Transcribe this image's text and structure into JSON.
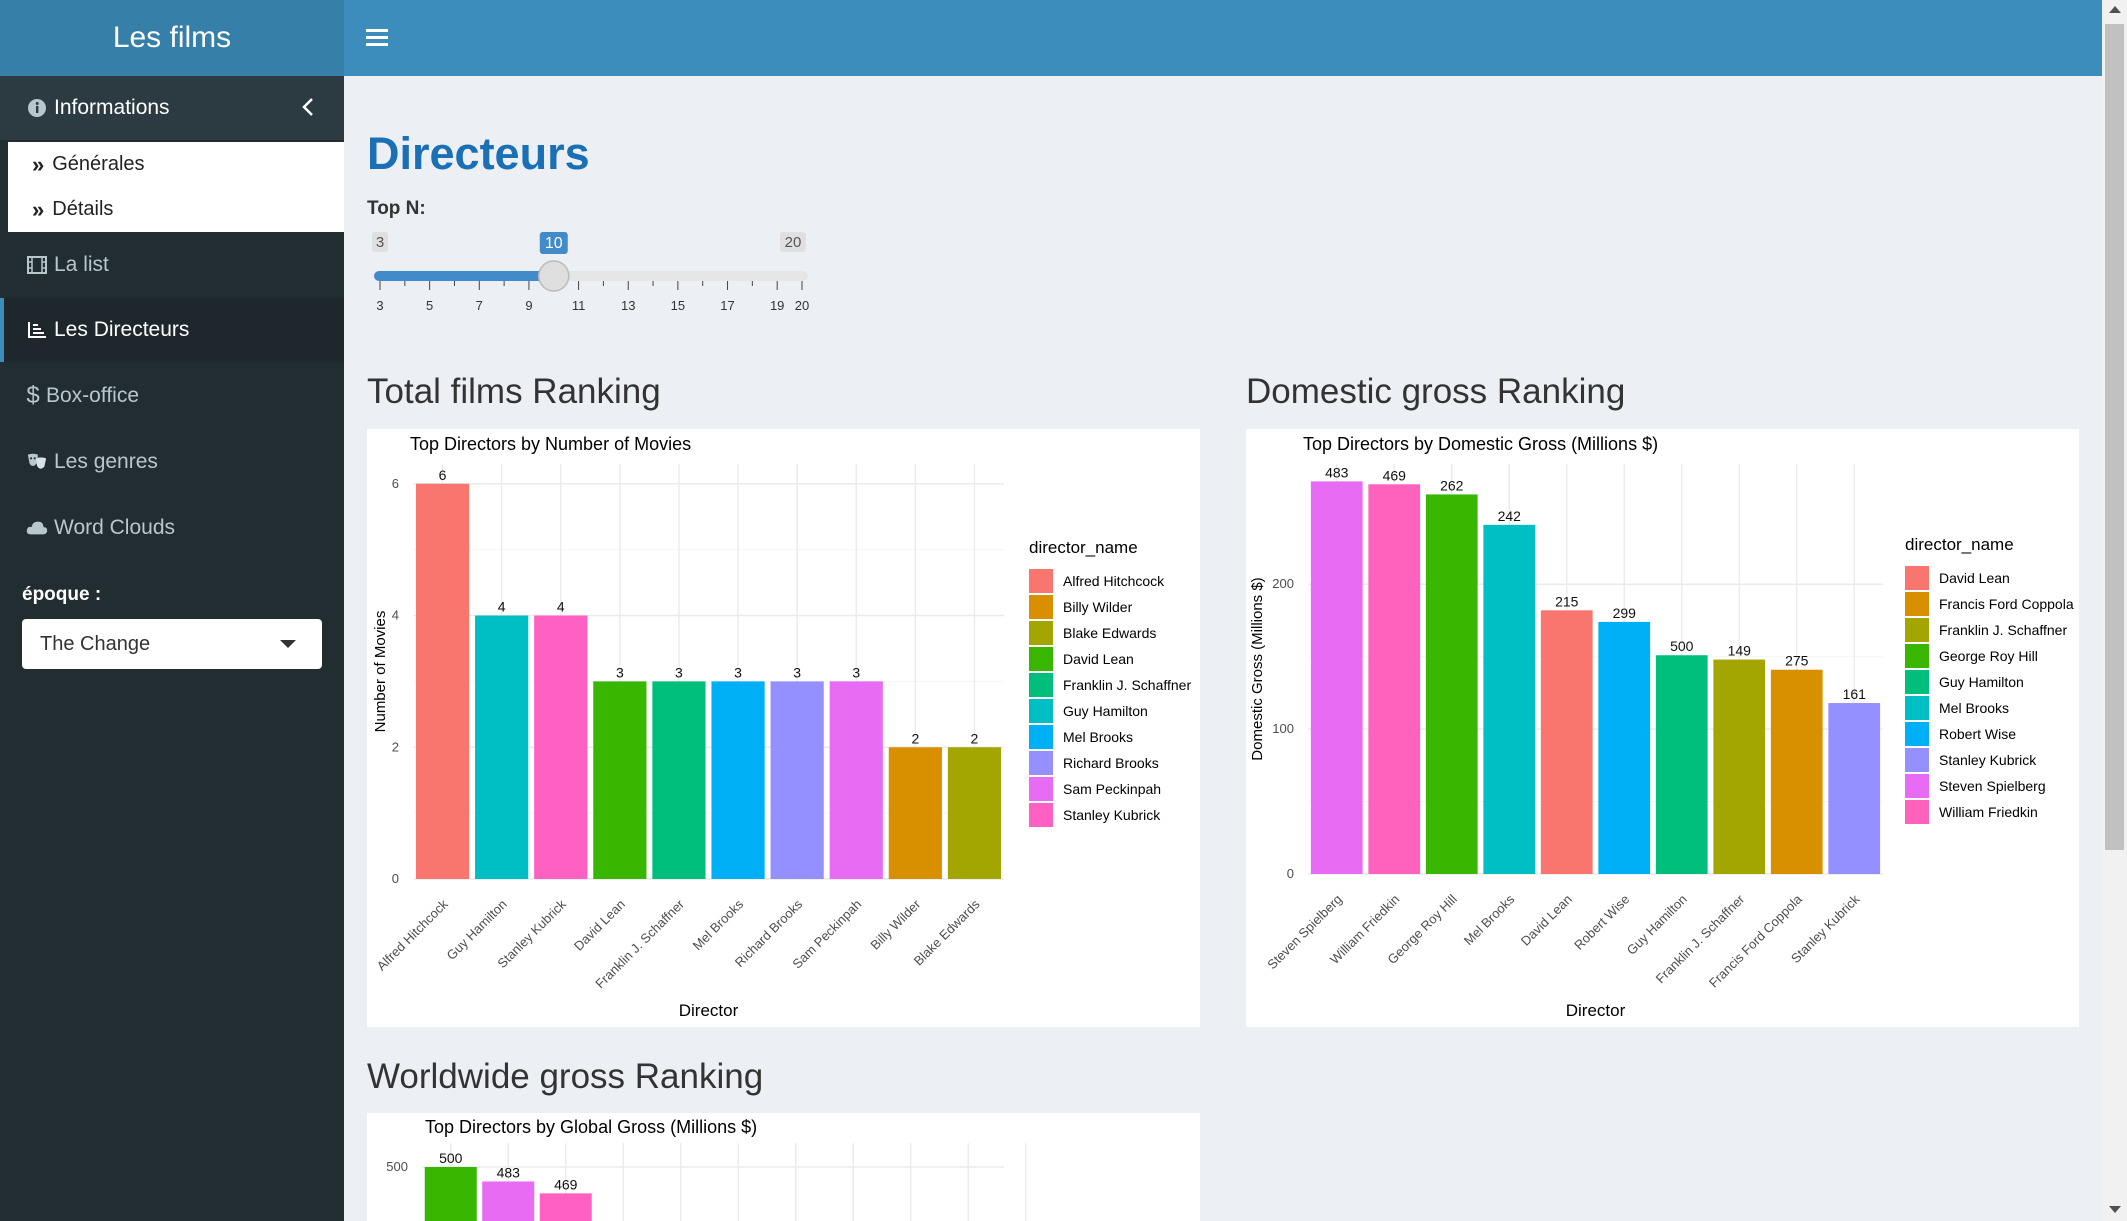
{
  "app": {
    "title": "Les films"
  },
  "sidebar": {
    "info": {
      "label": "Informations",
      "icon": "info-circle-icon"
    },
    "submenu": [
      {
        "label": "Générales"
      },
      {
        "label": "Détails"
      }
    ],
    "items": [
      {
        "label": "La list",
        "icon": "film-icon"
      },
      {
        "label": "Les Directeurs",
        "icon": "line-chart-icon"
      },
      {
        "label": "Box-office",
        "icon": "dollar-icon"
      },
      {
        "label": "Les genres",
        "icon": "theater-masks-icon"
      },
      {
        "label": "Word Clouds",
        "icon": "cloud-icon"
      }
    ],
    "epoque_label": "époque :",
    "epoque_value": "The Change"
  },
  "main": {
    "title": "Directeurs",
    "topn": {
      "label": "Top N:",
      "min": 3,
      "max": 20,
      "value": 10,
      "ticks": [
        "3",
        "5",
        "7",
        "9",
        "11",
        "13",
        "15",
        "17",
        "19",
        "20"
      ]
    },
    "sections": {
      "total": "Total films Ranking",
      "domestic": "Domestic gross Ranking",
      "worldwide": "Worldwide gross Ranking"
    }
  },
  "chart_data": [
    {
      "type": "bar",
      "title": "Top Directors by Number of Movies",
      "xlabel": "Director",
      "ylabel": "Number of Movies",
      "ylim": [
        0,
        6.3
      ],
      "yticks": [
        0,
        2,
        4,
        6
      ],
      "legend_title": "director_name",
      "legend_position": "right",
      "categories": [
        "Alfred Hitchcock",
        "Guy Hamilton",
        "Stanley Kubrick",
        "David Lean",
        "Franklin J. Schaffner",
        "Mel Brooks",
        "Richard Brooks",
        "Sam Peckinpah",
        "Billy Wilder",
        "Blake Edwards"
      ],
      "values": [
        6,
        4,
        4,
        3,
        3,
        3,
        3,
        3,
        2,
        2
      ],
      "labels": [
        "6",
        "4",
        "4",
        "3",
        "3",
        "3",
        "3",
        "3",
        "2",
        "2"
      ],
      "colors": [
        "#F8766D",
        "#00BFC4",
        "#FF61C3",
        "#39B600",
        "#00BF7D",
        "#00B0F6",
        "#9590FF",
        "#E76BF3",
        "#D89000",
        "#A3A500"
      ],
      "legend": [
        {
          "name": "Alfred Hitchcock",
          "color": "#F8766D"
        },
        {
          "name": "Billy Wilder",
          "color": "#D89000"
        },
        {
          "name": "Blake Edwards",
          "color": "#A3A500"
        },
        {
          "name": "David Lean",
          "color": "#39B600"
        },
        {
          "name": "Franklin J. Schaffner",
          "color": "#00BF7D"
        },
        {
          "name": "Guy Hamilton",
          "color": "#00BFC4"
        },
        {
          "name": "Mel Brooks",
          "color": "#00B0F6"
        },
        {
          "name": "Richard Brooks",
          "color": "#9590FF"
        },
        {
          "name": "Sam Peckinpah",
          "color": "#E76BF3"
        },
        {
          "name": "Stanley Kubrick",
          "color": "#FF61C3"
        }
      ]
    },
    {
      "type": "bar",
      "title": "Top Directors by Domestic Gross (Millions $)",
      "xlabel": "Director",
      "ylabel": "Domestic Gross (Millions $)",
      "ylim": [
        0,
        283
      ],
      "yticks": [
        0,
        100,
        200
      ],
      "legend_title": "director_name",
      "legend_position": "right",
      "categories": [
        "Steven Spielberg",
        "William Friedkin",
        "George Roy Hill",
        "Mel Brooks",
        "David Lean",
        "Robert Wise",
        "Guy Hamilton",
        "Franklin J. Schaffner",
        "Francis Ford Coppola",
        "Stanley Kubrick"
      ],
      "values": [
        271,
        269,
        262,
        241,
        182,
        174,
        151,
        148,
        141,
        118
      ],
      "labels": [
        "483",
        "469",
        "262",
        "242",
        "215",
        "299",
        "500",
        "149",
        "275",
        "161"
      ],
      "colors": [
        "#E76BF3",
        "#FF62BC",
        "#39B600",
        "#00BFC4",
        "#F8766D",
        "#00B0F6",
        "#00BF7D",
        "#A3A500",
        "#D89000",
        "#9590FF"
      ],
      "legend": [
        {
          "name": "David Lean",
          "color": "#F8766D"
        },
        {
          "name": "Francis Ford Coppola",
          "color": "#D89000"
        },
        {
          "name": "Franklin J. Schaffner",
          "color": "#A3A500"
        },
        {
          "name": "George Roy Hill",
          "color": "#39B600"
        },
        {
          "name": "Guy Hamilton",
          "color": "#00BF7D"
        },
        {
          "name": "Mel Brooks",
          "color": "#00BFC4"
        },
        {
          "name": "Robert Wise",
          "color": "#00B0F6"
        },
        {
          "name": "Stanley Kubrick",
          "color": "#9590FF"
        },
        {
          "name": "Steven Spielberg",
          "color": "#E76BF3"
        },
        {
          "name": "William Friedkin",
          "color": "#FF62BC"
        }
      ]
    },
    {
      "type": "bar",
      "title": "Top Directors by Global Gross (Millions $)",
      "yticks": [
        500
      ],
      "categories": [
        "",
        "",
        ""
      ],
      "values": [
        500,
        483,
        469
      ],
      "labels": [
        "500",
        "483",
        "469"
      ],
      "colors": [
        "#39B600",
        "#E76BF3",
        "#FF61C3"
      ]
    }
  ]
}
